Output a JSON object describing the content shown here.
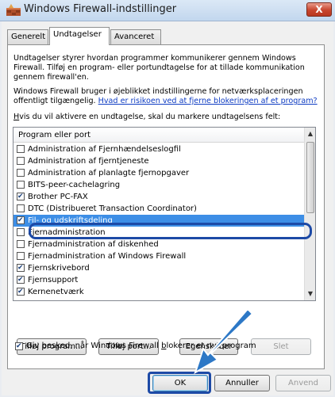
{
  "window": {
    "title": "Windows Firewall-indstillinger",
    "close_label": "X"
  },
  "tabs": [
    {
      "label": "Generelt",
      "active": false
    },
    {
      "label": "Undtagelser",
      "active": true
    },
    {
      "label": "Avanceret",
      "active": false
    }
  ],
  "intro": {
    "line1": "Undtagelser styrer hvordan programmer kommunikerer gennem Windows",
    "line2": "Firewall. Tilføj en program- eller portundtagelse for at tillade kommunikation",
    "line3": "gennem firewall'en.",
    "line4": "Windows Firewall bruger i øjeblikket indstillingerne for netværksplaceringen",
    "line5_text": "offentligt tilgængelig. ",
    "line5_link": "Hvad er risikoen ved at fjerne blokeringen af et program?",
    "line6_ak": "H",
    "line6_rest": "vis du vil aktivere en undtagelse, skal du markere undtagelsens felt:"
  },
  "list": {
    "header": "Program eller port",
    "items": [
      {
        "label": "Administration af Fjernhændelseslogfil",
        "checked": false,
        "selected": false
      },
      {
        "label": "Administration af fjerntjeneste",
        "checked": false,
        "selected": false
      },
      {
        "label": "Administration af planlagte fjernopgaver",
        "checked": false,
        "selected": false
      },
      {
        "label": "BITS-peer-cachelagring",
        "checked": false,
        "selected": false
      },
      {
        "label": "Brother PC-FAX",
        "checked": true,
        "selected": false
      },
      {
        "label": "DTC (Distribueret Transaction Coordinator)",
        "checked": false,
        "selected": false
      },
      {
        "label": "Fil- og udskriftsdeling",
        "checked": true,
        "selected": true
      },
      {
        "label": "Fjernadministration",
        "checked": false,
        "selected": false
      },
      {
        "label": "Fjernadministration af diskenhed",
        "checked": false,
        "selected": false
      },
      {
        "label": "Fjernadministration af Windows Firewall",
        "checked": false,
        "selected": false
      },
      {
        "label": "Fjernskrivebord",
        "checked": true,
        "selected": false
      },
      {
        "label": "Fjernsupport",
        "checked": true,
        "selected": false
      },
      {
        "label": "Kernenetværk",
        "checked": true,
        "selected": false
      }
    ]
  },
  "buttons": {
    "add_program": "Tilføj program...",
    "add_port": "Tilføj port...",
    "properties": "Egenskaber",
    "delete": "Slet",
    "ok": "OK",
    "cancel": "Annuller",
    "apply": "Anvend"
  },
  "notify": {
    "label_part1": "Giv besked, når Windows Firewall ",
    "label_ak": "b",
    "label_part2": "lokerer et nyt program",
    "checked": true
  },
  "colors": {
    "selection": "#3d8ee6",
    "highlight_ring": "#1d4aa6",
    "arrow": "#2d78c6",
    "link": "#0d3bc2"
  }
}
